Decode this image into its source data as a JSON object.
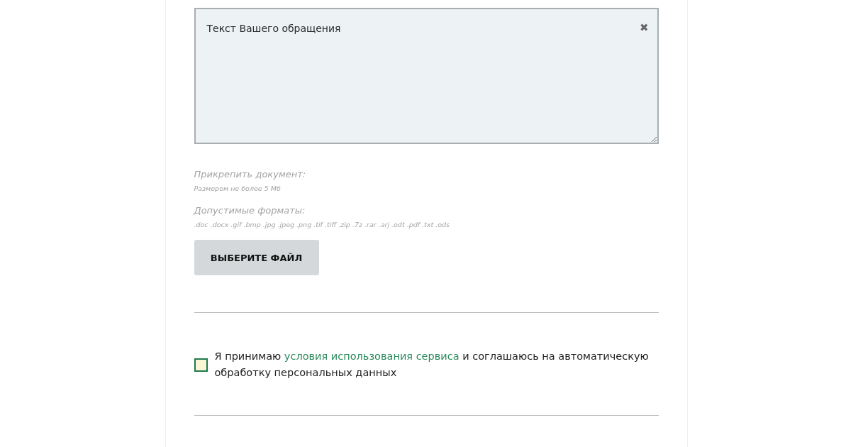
{
  "message_field": {
    "placeholder": "Текст Вашего обращения",
    "clear_icon": "✖"
  },
  "attachment": {
    "label": "Прикрепить документ:",
    "size_note": "Размером не более 5 Мб",
    "formats_label": "Допустимые форматы:",
    "formats": ".doc .docx .gif .bmp .jpg .jpeg .png .tif .tiff .zip .7z .rar .arj .odt .pdf .txt .ods",
    "button": "ВЫБЕРИТЕ ФАЙЛ"
  },
  "consent": {
    "checked": false,
    "text_before": "Я принимаю",
    "link": "условия использования сервиса",
    "text_after": "и соглашаюсь на автоматическую обработку персональных данных"
  }
}
